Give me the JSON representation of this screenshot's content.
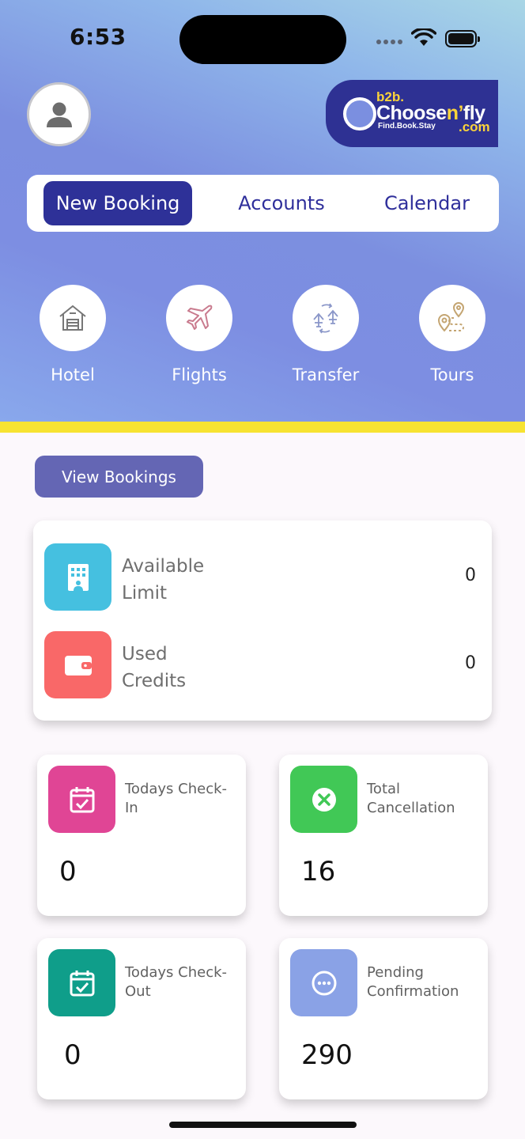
{
  "status_bar": {
    "time": "6:53"
  },
  "header": {
    "logo": {
      "b2b": "b2b.",
      "brand_prefix": "Choose",
      "brand_n": "n’",
      "brand_suffix": "fly",
      "tagline": "Find.Book.Stay",
      "com": ".com"
    }
  },
  "tabs": [
    {
      "label": "New Booking",
      "active": true
    },
    {
      "label": "Accounts",
      "active": false
    },
    {
      "label": "Calendar",
      "active": false
    }
  ],
  "services": [
    {
      "label": "Hotel",
      "icon": "hotel-icon"
    },
    {
      "label": "Flights",
      "icon": "airplane-icon"
    },
    {
      "label": "Transfer",
      "icon": "transfer-icon"
    },
    {
      "label": "Tours",
      "icon": "map-pin-route-icon"
    }
  ],
  "view_bookings_label": "View Bookings",
  "limits": [
    {
      "label": "Available Limit",
      "value": "0",
      "icon": "building-icon",
      "color": "#45c0e0"
    },
    {
      "label": "Used Credits",
      "value": "0",
      "icon": "wallet-icon",
      "color": "#f96868"
    }
  ],
  "stats": [
    {
      "label": "Todays Check-In",
      "value": "0",
      "icon": "calendar-check-icon",
      "color": "#e04595"
    },
    {
      "label": "Total Cancellation",
      "value": "16",
      "icon": "cancel-circle-icon",
      "color": "#41c856"
    },
    {
      "label": "Todays Check-Out",
      "value": "0",
      "icon": "calendar-check-icon",
      "color": "#0f9e8a"
    },
    {
      "label": "Pending Confirmation",
      "value": "290",
      "icon": "more-circle-icon",
      "color": "#8aa2e6"
    }
  ],
  "colors": {
    "accent": "#2e3198",
    "view_button": "#6466b4",
    "strip": "#f7e332"
  }
}
